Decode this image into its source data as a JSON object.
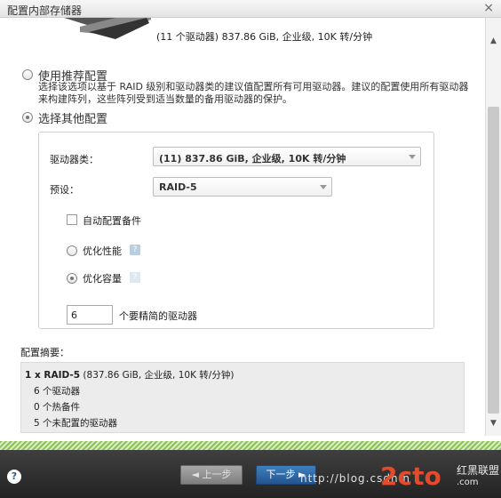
{
  "window": {
    "title": "配置内部存储器",
    "close_glyph": "×"
  },
  "drive_summary_line": "(11 个驱动器) 837.86 GiB, 企业级, 10K 转/分钟",
  "options": {
    "recommended": {
      "label": "使用推荐配置",
      "description": "选择该选项以基于 RAID 级别和驱动器类的建议值配置所有可用驱动器。建议的配置使用所有驱动器来构建阵列，这些阵列受到适当数量的备用驱动器的保护。",
      "selected": false
    },
    "other": {
      "label": "选择其他配置",
      "selected": true
    }
  },
  "panel": {
    "drive_class_label": "驱动器类：",
    "drive_class_value": "(11) 837.86 GiB, 企业级, 10K 转/分钟",
    "preset_label": "预设：",
    "preset_value": "RAID-5",
    "auto_spare_label": "自动配置备件",
    "auto_spare_checked": false,
    "optimize_performance_label": "优化性能",
    "optimize_capacity_label": "优化容量",
    "optimize_selected": "capacity",
    "help_glyph": "?",
    "drive_count_value": "6",
    "drive_count_label": "个要精简的驱动器"
  },
  "summary": {
    "title": "配置摘要：",
    "line1_bold": "1 x RAID-5",
    "line1_rest": " (837.86 GiB, 企业级, 10K 转/分钟)",
    "line2": "6 个驱动器",
    "line3": "0 个热备件",
    "line4": "5 个未配置的驱动器"
  },
  "footer": {
    "help_glyph": "?",
    "prev_label": "◄ 上一步",
    "next_label": "下一步 ►",
    "watermark_url": "http://blog.csdn.n",
    "watermark_logo": "2cto",
    "watermark_brand": "红黑联盟",
    "watermark_com": ".com"
  },
  "colors": {
    "accent": "#2d6aa8",
    "stripe": "#8fc05a",
    "footer": "#2b2b2b"
  }
}
